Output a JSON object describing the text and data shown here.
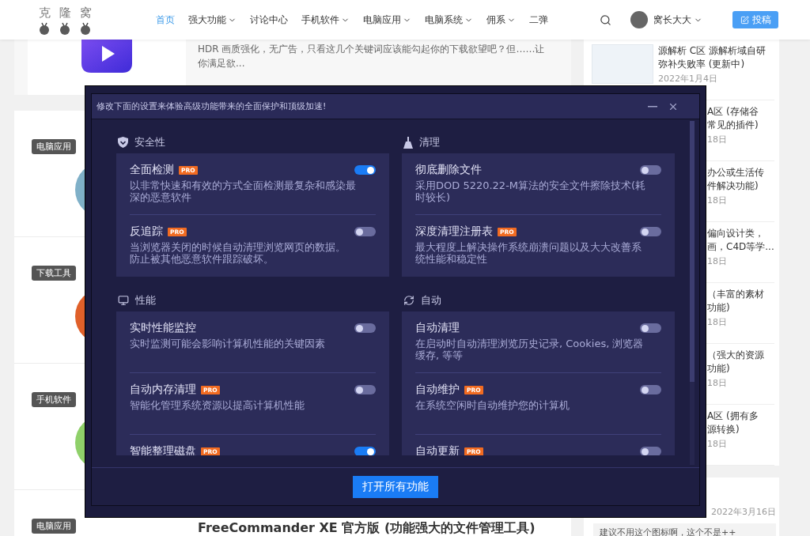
{
  "header": {
    "logo": [
      "克",
      "隆",
      "窝"
    ],
    "nav": [
      {
        "label": "首页",
        "selected": true,
        "dropdown": false
      },
      {
        "label": "强大功能",
        "selected": false,
        "dropdown": true
      },
      {
        "label": "讨论中心",
        "selected": false,
        "dropdown": false
      },
      {
        "label": "手机软件",
        "selected": false,
        "dropdown": true
      },
      {
        "label": "电脑应用",
        "selected": false,
        "dropdown": true
      },
      {
        "label": "电脑系统",
        "selected": false,
        "dropdown": true
      },
      {
        "label": "佣系",
        "selected": false,
        "dropdown": true
      },
      {
        "label": "二弹",
        "selected": false,
        "dropdown": false
      }
    ],
    "user": "窝长大大",
    "post_button": "投稿"
  },
  "top_article": {
    "excerpt": "HDR 画质强化，无广告，只看这几个关键词应该能勾起你的下载欲望吧？但……让你满足欲..."
  },
  "articles": [
    {
      "tag": "电脑应用"
    },
    {
      "tag": "下载工具"
    },
    {
      "tag": "手机软件"
    },
    {
      "tag": "电脑应用",
      "title": "FreeCommander XE 官方版 (功能强大的文件管理工具)"
    }
  ],
  "sidebar": {
    "posts": [
      {
        "title": "源解析 C区 源解析域自研弥补失败率 (更新中)",
        "date": "2022年1月4日"
      },
      {
        "title_fragments": [
          "A区 (存储谷",
          "常见的插件)"
        ],
        "date": "18日"
      },
      {
        "title_fragments": [
          "办公或生活传",
          "件解决功能)"
        ],
        "date": "18日"
      },
      {
        "title_fragments": [
          "偏向设计类，",
          "画，C4D等学..."
        ],
        "date": "18日"
      },
      {
        "title_fragments": [
          "（丰富的素材",
          "功能)"
        ],
        "date": "18日"
      },
      {
        "title_fragments": [
          "（强大的资源",
          "功能)"
        ],
        "date": "18日"
      },
      {
        "title_fragments": [
          "A区 (拥有多",
          "源转换)"
        ],
        "date": "18日"
      }
    ],
    "comment": {
      "date": "2022年3月16日",
      "text": "建议不用这个图标啊，这个不是++"
    }
  },
  "dialog": {
    "title": "修改下面的设置来体验高级功能带来的全面保护和顶级加速!",
    "sections": [
      {
        "label": "安全性",
        "items": [
          {
            "title": "全面检测",
            "badge": "PRO",
            "on": true,
            "description": "以非常快速和有效的方式全面检测最复杂和感染最深的恶意软件"
          },
          {
            "title": "反追踪",
            "badge": "PRO",
            "on": false,
            "description": [
              "当浏览器关闭的时候自动清理浏览网页的数据。",
              "防止被其他恶意软件跟踪破坏。"
            ]
          }
        ]
      },
      {
        "label": "清理",
        "items": [
          {
            "title": "彻底删除文件",
            "on": false,
            "description": "采用DOD 5220.22-M算法的安全文件擦除技术(耗时较长)"
          },
          {
            "title": "深度清理注册表",
            "badge": "PRO",
            "on": false,
            "description": "最大程度上解决操作系统崩溃问题以及大大改善系统性能和稳定性"
          }
        ]
      },
      {
        "label": "性能",
        "items": [
          {
            "title": "实时性能监控",
            "on": false,
            "description": "实时监测可能会影响计算机性能的关键因素"
          },
          {
            "title": "自动内存清理",
            "badge": "PRO",
            "on": false,
            "description": "智能化管理系统资源以提高计算机性能"
          },
          {
            "title": "智能整理磁盘",
            "badge": "PRO",
            "on": true
          }
        ]
      },
      {
        "label": "自动",
        "items": [
          {
            "title": "自动清理",
            "on": false,
            "description": "在启动时自动清理浏览历史记录, Cookies, 浏览器缓存, 等等"
          },
          {
            "title": "自动维护",
            "badge": "PRO",
            "on": false,
            "description": "在系统空闲时自动维护您的计算机"
          },
          {
            "title": "自动更新",
            "badge": "PRO",
            "on": false
          }
        ]
      }
    ],
    "button": "打开所有功能"
  }
}
